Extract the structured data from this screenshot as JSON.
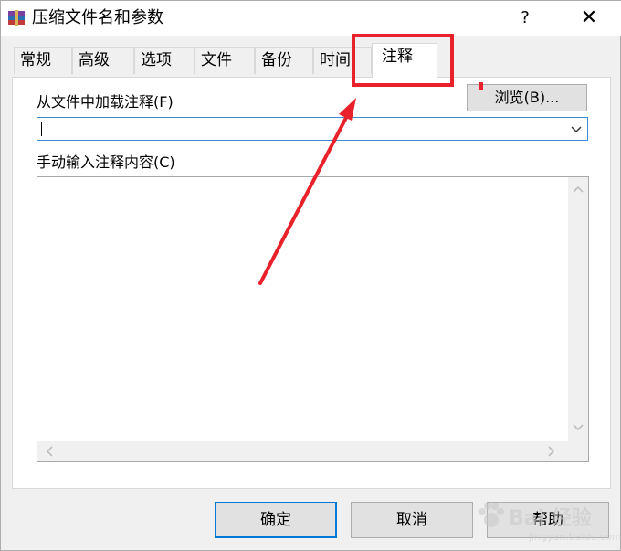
{
  "window": {
    "title": "压缩文件名和参数",
    "help_label": "?",
    "close_label": "✕"
  },
  "tabs": [
    {
      "label": "常规"
    },
    {
      "label": "高级"
    },
    {
      "label": "选项"
    },
    {
      "label": "文件"
    },
    {
      "label": "备份"
    },
    {
      "label": "时间"
    },
    {
      "label": "注释"
    }
  ],
  "active_tab": "注释",
  "load_comment": {
    "label": "从文件中加载注释(F)",
    "browse_label": "浏览(B)...",
    "value": ""
  },
  "manual_comment": {
    "label": "手动输入注释内容(C)",
    "value": ""
  },
  "buttons": {
    "ok": "确定",
    "cancel": "取消",
    "help": "帮助"
  },
  "watermark": {
    "text": "Bai 经验",
    "sub": "jingyan.baidu.com"
  },
  "colors": {
    "annotation_red": "#e8212a",
    "focus_blue": "#0078d7"
  }
}
